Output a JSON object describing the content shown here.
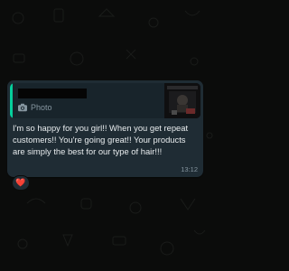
{
  "message": {
    "quoted": {
      "author": "",
      "preview_label": "Photo",
      "preview_icon": "camera-icon"
    },
    "text": "I'm so happy for you girl!! When you get repeat customers!! You're going great!! Your products are simply the best for our type of hair!!!",
    "time": "13:12",
    "reaction": "❤️"
  },
  "colors": {
    "chat_background": "#0b0c0b",
    "bubble": "#1f2c34",
    "quote_accent": "#06cf9c",
    "text": "#e9edef",
    "meta_text": "#8696a0",
    "heart": "#e53945"
  }
}
